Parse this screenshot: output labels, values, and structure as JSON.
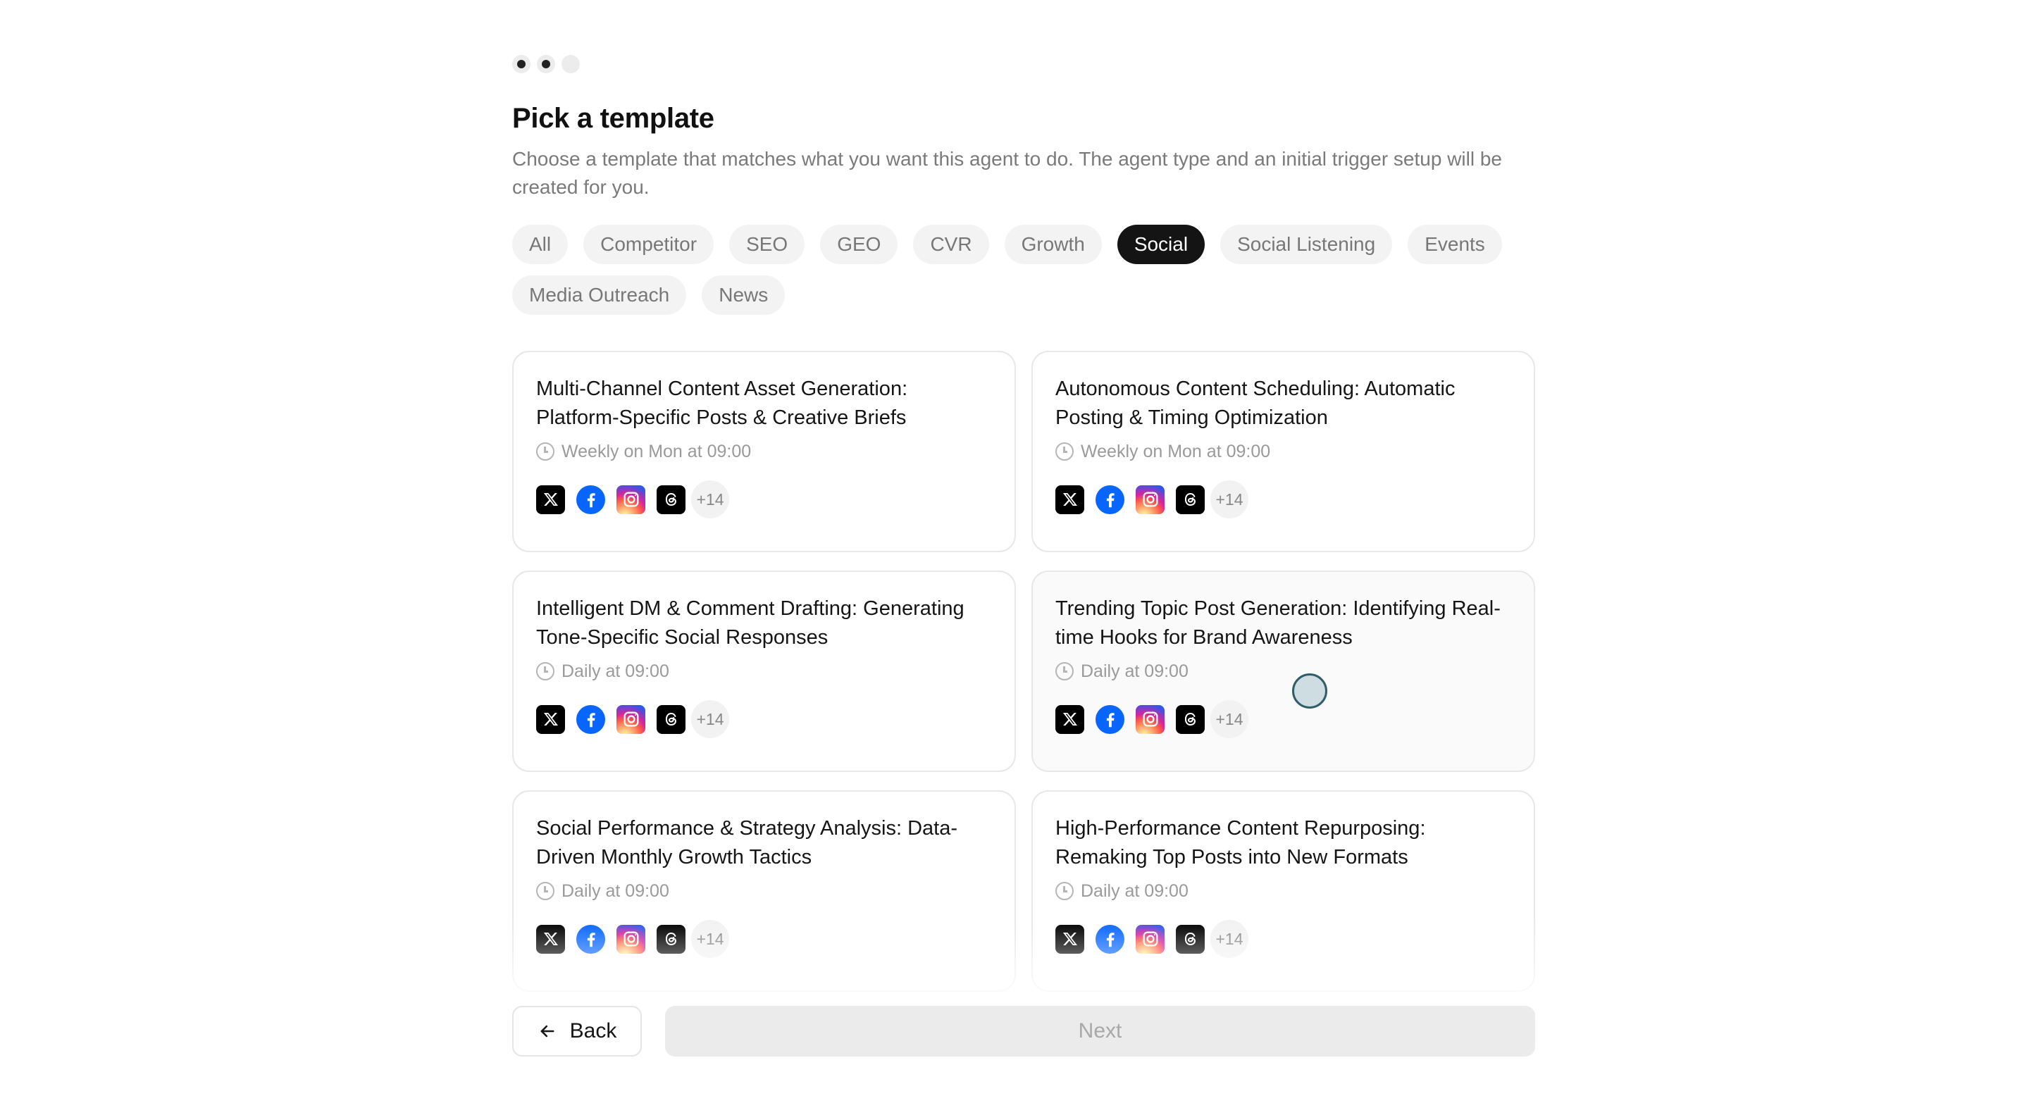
{
  "progress": {
    "total_steps": 3,
    "completed_steps": 2
  },
  "header": {
    "title": "Pick a template",
    "description": "Choose a template that matches what you want this agent to do. The agent type and an initial trigger setup will be created for you."
  },
  "filters": {
    "active": "Social",
    "items": [
      {
        "label": "All"
      },
      {
        "label": "Competitor"
      },
      {
        "label": "SEO"
      },
      {
        "label": "GEO"
      },
      {
        "label": "CVR"
      },
      {
        "label": "Growth"
      },
      {
        "label": "Social"
      },
      {
        "label": "Social Listening"
      },
      {
        "label": "Events"
      },
      {
        "label": "Media Outreach"
      },
      {
        "label": "News"
      }
    ]
  },
  "templates": [
    {
      "title": "Multi-Channel Content Asset Generation: Platform-Specific Posts & Creative Briefs",
      "schedule": "Weekly on Mon at 09:00",
      "platforms": [
        "x-icon",
        "facebook-icon",
        "instagram-icon",
        "threads-icon"
      ],
      "more": "+14"
    },
    {
      "title": "Autonomous Content Scheduling: Automatic Posting & Timing Optimization",
      "schedule": "Weekly on Mon at 09:00",
      "platforms": [
        "x-icon",
        "facebook-icon",
        "instagram-icon",
        "threads-icon"
      ],
      "more": "+14"
    },
    {
      "title": "Intelligent DM & Comment Drafting: Generating Tone-Specific Social Responses",
      "schedule": "Daily at 09:00",
      "platforms": [
        "x-icon",
        "facebook-icon",
        "instagram-icon",
        "threads-icon"
      ],
      "more": "+14"
    },
    {
      "title": "Trending Topic Post Generation: Identifying Real-time Hooks for Brand Awareness",
      "schedule": "Daily at 09:00",
      "platforms": [
        "x-icon",
        "facebook-icon",
        "instagram-icon",
        "threads-icon"
      ],
      "more": "+14"
    },
    {
      "title": "Social Performance & Strategy Analysis: Data-Driven Monthly Growth Tactics",
      "schedule": "Daily at 09:00",
      "platforms": [
        "x-icon",
        "facebook-icon",
        "instagram-icon",
        "threads-icon"
      ],
      "more": "+14"
    },
    {
      "title": "High-Performance Content Repurposing: Remaking Top Posts into New Formats",
      "schedule": "Daily at 09:00",
      "platforms": [
        "x-icon",
        "facebook-icon",
        "instagram-icon",
        "threads-icon"
      ],
      "more": "+14"
    }
  ],
  "footer": {
    "back_label": "Back",
    "next_label": "Next"
  },
  "colors": {
    "active_chip": "#141414",
    "chip_bg": "#f3f3f3",
    "facebook": "#0866ff"
  }
}
